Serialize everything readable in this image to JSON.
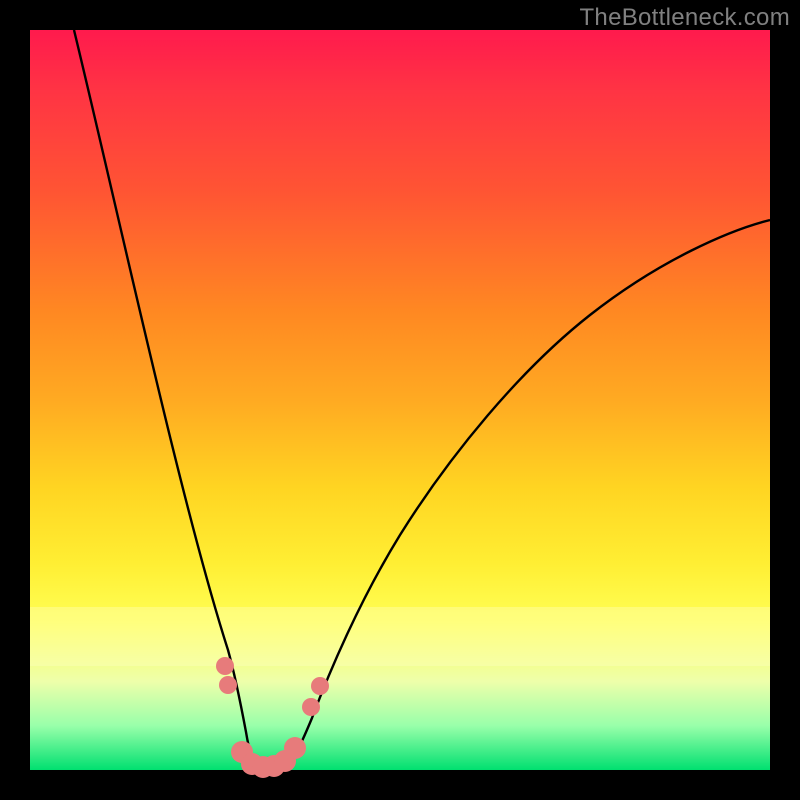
{
  "watermark": "TheBottleneck.com",
  "chart_data": {
    "type": "line",
    "title": "",
    "xlabel": "",
    "ylabel": "",
    "xlim": [
      0,
      100
    ],
    "ylim": [
      0,
      100
    ],
    "series": [
      {
        "name": "curve-left",
        "x": [
          6,
          8,
          10,
          12,
          14,
          16,
          18,
          20,
          22,
          24,
          26,
          27,
          28,
          29
        ],
        "values": [
          100,
          93,
          86,
          79,
          71,
          63,
          55,
          46,
          37,
          27,
          16,
          10,
          5,
          1
        ]
      },
      {
        "name": "curve-bottom",
        "x": [
          29,
          30,
          31,
          32,
          33,
          34,
          35
        ],
        "values": [
          1,
          0.3,
          0,
          0,
          0,
          0.3,
          1
        ]
      },
      {
        "name": "curve-right",
        "x": [
          35,
          37,
          40,
          44,
          48,
          53,
          58,
          64,
          70,
          77,
          84,
          92,
          100
        ],
        "values": [
          1,
          5,
          12,
          20,
          27,
          34,
          41,
          48,
          54,
          60,
          65,
          70,
          74
        ]
      }
    ],
    "markers": {
      "name": "highlight-dots",
      "color": "#e77b7b",
      "points": [
        {
          "x": 26.3,
          "y": 14
        },
        {
          "x": 26.8,
          "y": 11.5
        },
        {
          "x": 28.6,
          "y": 2.5
        },
        {
          "x": 30.0,
          "y": 0.8
        },
        {
          "x": 31.5,
          "y": 0.4
        },
        {
          "x": 33.0,
          "y": 0.5
        },
        {
          "x": 34.5,
          "y": 1.2
        },
        {
          "x": 35.8,
          "y": 3.0
        },
        {
          "x": 38.0,
          "y": 8.5
        },
        {
          "x": 39.2,
          "y": 11.3
        }
      ]
    },
    "background_gradient": {
      "orientation": "vertical",
      "stops": [
        {
          "pos": 0.0,
          "color": "#ff1a4d"
        },
        {
          "pos": 0.5,
          "color": "#ffaa22"
        },
        {
          "pos": 0.8,
          "color": "#ffff55"
        },
        {
          "pos": 1.0,
          "color": "#00e070"
        }
      ]
    }
  }
}
